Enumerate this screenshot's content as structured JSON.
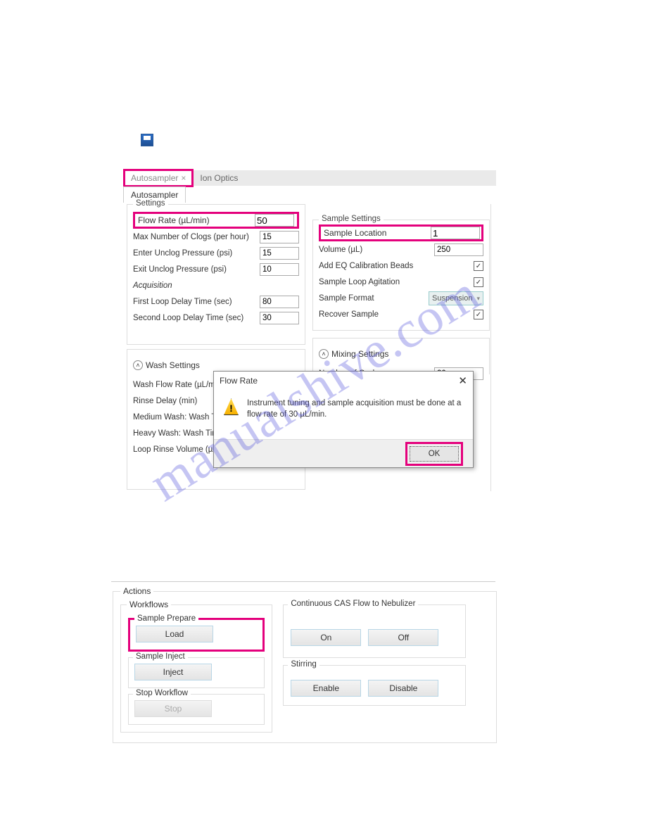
{
  "save_icon": "save-icon",
  "tabs": {
    "autosampler": "Autosampler",
    "ion_optics": "Ion Optics"
  },
  "sub_tab": "Autosampler",
  "settings": {
    "title": "Settings",
    "flow_rate_label": "Flow Rate (µL/min)",
    "flow_rate_value": "50",
    "max_clogs_label": "Max Number of Clogs (per hour)",
    "max_clogs_value": "15",
    "enter_unclog_label": "Enter Unclog Pressure (psi)",
    "enter_unclog_value": "15",
    "exit_unclog_label": "Exit Unclog Pressure (psi)",
    "exit_unclog_value": "10",
    "acquisition_title": "Acquisition",
    "first_loop_label": "First Loop Delay Time (sec)",
    "first_loop_value": "80",
    "second_loop_label": "Second Loop Delay Time (sec)",
    "second_loop_value": "30"
  },
  "sample_settings": {
    "title": "Sample Settings",
    "location_label": "Sample Location",
    "location_value": "1",
    "volume_label": "Volume (µL)",
    "volume_value": "250",
    "add_eq_label": "Add EQ Calibration Beads",
    "add_eq_checked": true,
    "agitation_label": "Sample Loop Agitation",
    "agitation_checked": true,
    "format_label": "Sample Format",
    "format_value": "Suspension",
    "recover_label": "Recover Sample",
    "recover_checked": true
  },
  "mixing": {
    "title": "Mixing Settings",
    "cycles_label": "Number of Cycles",
    "cycles_value": "20"
  },
  "wash": {
    "title": "Wash Settings",
    "flow_rate_label": "Wash Flow Rate (µL/m",
    "rinse_delay_label": "Rinse Delay (min)",
    "medium_wash_label": "Medium Wash: Wash T",
    "heavy_wash_label": "Heavy Wash: Wash Tim",
    "loop_rinse_label": "Loop Rinse Volume (µL"
  },
  "dialog": {
    "title": "Flow Rate",
    "message": "Instrument tuning and sample acquisition must be done at a flow rate of 30 µL/min.",
    "ok": "OK"
  },
  "actions": {
    "actions_title": "Actions",
    "workflows_title": "Workflows",
    "sample_prepare_title": "Sample Prepare",
    "load_btn": "Load",
    "sample_inject_title": "Sample Inject",
    "inject_btn": "Inject",
    "stop_workflow_title": "Stop Workflow",
    "stop_btn": "Stop",
    "cas_title": "Continuous CAS Flow to Nebulizer",
    "on_btn": "On",
    "off_btn": "Off",
    "stirring_title": "Stirring",
    "enable_btn": "Enable",
    "disable_btn": "Disable"
  },
  "watermark": "manualshive.com"
}
